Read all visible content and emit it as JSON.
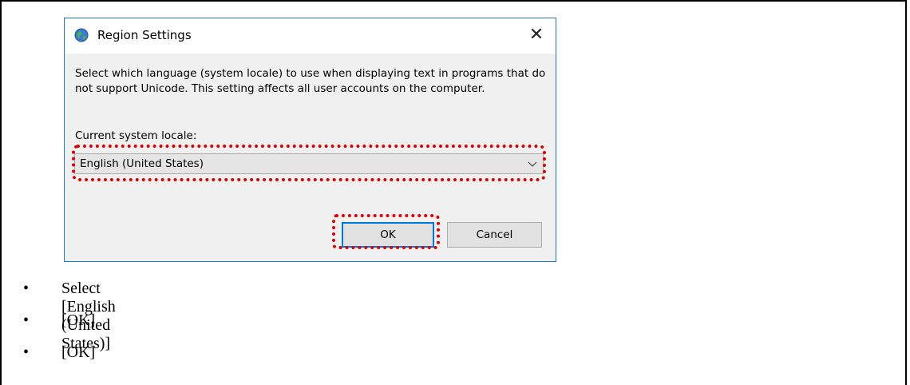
{
  "dialog": {
    "title": "Region Settings",
    "close_glyph": "✕",
    "description": "Select which language (system locale) to use when displaying text in programs that do not support Unicode. This setting affects all user accounts on the computer.",
    "locale_label": "Current system locale:",
    "locale_value": "English (United States)",
    "ok_label": "OK",
    "cancel_label": "Cancel",
    "icon": "globe-icon"
  },
  "highlight_color": "#e00000",
  "steps": [
    {
      "bullet": "•",
      "text": "Select [English (United States)]"
    },
    {
      "bullet": "•",
      "text": "[OK]"
    },
    {
      "bullet": "•",
      "text": "[OK]"
    }
  ]
}
